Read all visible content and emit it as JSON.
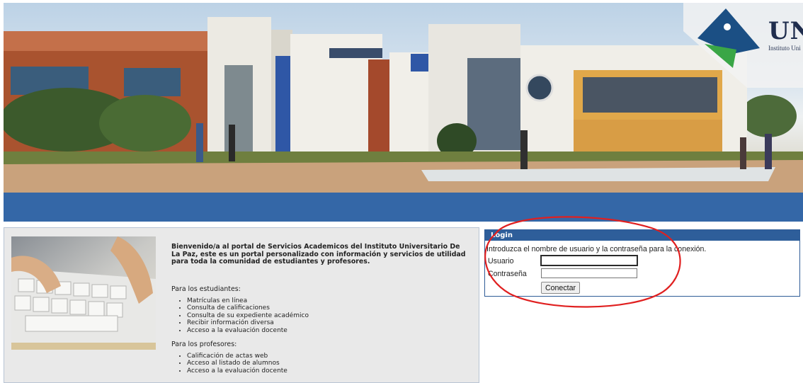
{
  "header": {
    "logo_text": "UN",
    "logo_subtitle": "Instituto Uni",
    "logo_icon": "bird-logo-icon",
    "colors": {
      "logo_blue": "#1b4f84",
      "logo_green": "#3aa646",
      "nav_bar": "#3467a7"
    }
  },
  "welcome": {
    "intro": "Bienvenido/a al portal de Servicios Academicos del Instituto Universitario De La Paz, este es un portal personalizado con información y servicios de utilidad para toda la comunidad de estudiantes y profesores.",
    "students_title": "Para los estudiantes:",
    "students_items": [
      "Matrículas en línea",
      "Consulta de calificaciones",
      "Consulta de su expediente académico",
      "Recibir información diversa",
      "Acceso a la evaluación docente"
    ],
    "teachers_title": "Para los profesores:",
    "teachers_items": [
      "Calificación de actas web",
      "Acceso al listado de alumnos",
      "Acceso a la evaluación docente"
    ]
  },
  "login": {
    "title": "Login",
    "intro": "Introduzca el nombre de usuario y la contraseña para la conexión.",
    "user_label": "Usuario",
    "user_value": "",
    "password_label": "Contraseña",
    "password_value": "",
    "connect_label": "Conectar",
    "colors": {
      "header": "#2e5e9a",
      "annotation": "#e02020"
    }
  }
}
